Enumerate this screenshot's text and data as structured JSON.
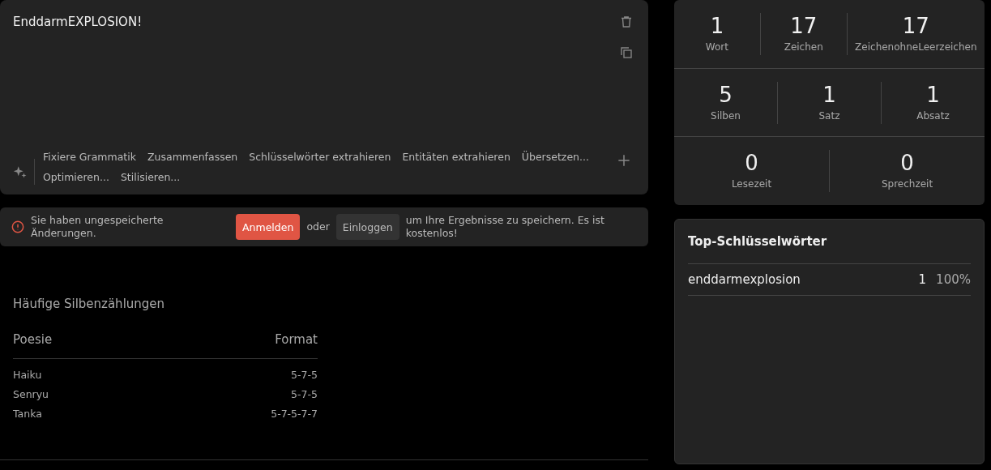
{
  "editor": {
    "text": "EnddarmEXPLOSION!",
    "actions": [
      [
        "Fixiere Grammatik",
        "Zusammenfassen",
        "Schlüsselwörter extrahieren",
        "Entitäten extrahieren",
        "Übersetzen..."
      ],
      [
        "Optimieren...",
        "Stilisieren..."
      ]
    ]
  },
  "notice": {
    "message": "Sie haben ungespeicherte Änderungen.",
    "signup": "Anmelden",
    "or": "oder",
    "login": "Einloggen",
    "tail": "um Ihre Ergebnisse zu speichern. Es ist kostenlos!"
  },
  "syllables": {
    "title": "Häufige Silbenzählungen",
    "columns": [
      "Poesie",
      "Format"
    ],
    "rows": [
      [
        "Haiku",
        "5-7-5"
      ],
      [
        "Senryu",
        "5-7-5"
      ],
      [
        "Tanka",
        "5-7-5-7-7"
      ]
    ]
  },
  "stats": [
    [
      {
        "value": "1",
        "label": "Wort"
      },
      {
        "value": "17",
        "label": "Zeichen"
      },
      {
        "value": "17",
        "label": "ZeichenohneLeerzeichen"
      }
    ],
    [
      {
        "value": "5",
        "label": "Silben"
      },
      {
        "value": "1",
        "label": "Satz"
      },
      {
        "value": "1",
        "label": "Absatz"
      }
    ],
    [
      {
        "value": "0",
        "label": "Lesezeit"
      },
      {
        "value": "0",
        "label": "Sprechzeit"
      }
    ]
  ],
  "keywords": {
    "title": "Top-Schlüsselwörter",
    "rows": [
      {
        "word": "enddarmexplosion",
        "count": "1",
        "share": "100%"
      }
    ]
  }
}
